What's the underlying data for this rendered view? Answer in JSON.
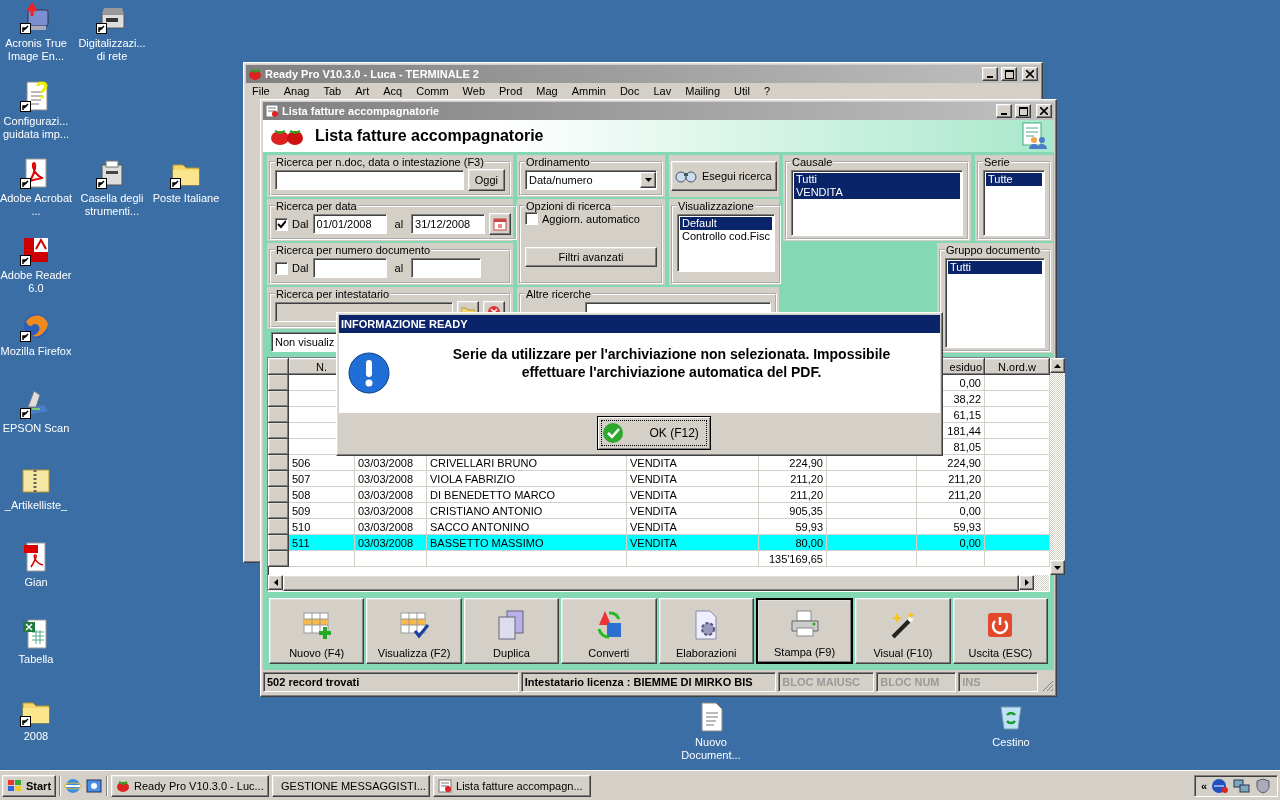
{
  "desktop_icons": [
    {
      "label": "Acronis True Image En...",
      "shortcut": true
    },
    {
      "label": "Digitalizzazi... di rete",
      "shortcut": true
    },
    {
      "label": "Configurazi... guidata imp...",
      "shortcut": true
    },
    {
      "label": "Adobe Acrobat ...",
      "shortcut": true
    },
    {
      "label": "Casella degli strumenti...",
      "shortcut": true
    },
    {
      "label": "Poste Italiane",
      "shortcut": true
    },
    {
      "label": "Adobe Reader 6.0",
      "shortcut": true
    },
    {
      "label": "Mozilla Firefox",
      "shortcut": true
    },
    {
      "label": "EPSON Scan",
      "shortcut": true
    },
    {
      "label": "_Artikelliste_",
      "shortcut": false
    },
    {
      "label": "Gian",
      "shortcut": false
    },
    {
      "label": "Tabella",
      "shortcut": false
    },
    {
      "label": "2008",
      "shortcut": true
    },
    {
      "label": "Nuovo Document...",
      "shortcut": false
    },
    {
      "label": "Cestino",
      "shortcut": false
    }
  ],
  "back_window": {
    "title": "Ready Pro V10.3.0 - Luca - TERMINALE 2",
    "menu": [
      "File",
      "Anag",
      "Tab",
      "Art",
      "Acq",
      "Comm",
      "Web",
      "Prod",
      "Mag",
      "Ammin",
      "Doc",
      "Lav",
      "Mailing",
      "Util",
      "?"
    ]
  },
  "window": {
    "title": "Lista fatture accompagnatorie",
    "heading": "Lista fatture accompagnatorie",
    "search_panel": {
      "label": "Ricerca per n.doc, data o intestazione (F3)",
      "button": "Oggi"
    },
    "date_panel": {
      "label": "Ricerca per data",
      "checkbox": {
        "label": "Dal",
        "checked": true
      },
      "from": "01/01/2008",
      "to_label": "al",
      "to": "31/12/2008"
    },
    "number_panel": {
      "label": "Ricerca per numero documento",
      "checkbox": {
        "label": "Dal",
        "checked": false
      },
      "to_label": "al"
    },
    "holder_panel": {
      "label": "Ricerca per intestatario"
    },
    "ordering": {
      "label": "Ordinamento",
      "value": "Data/numero"
    },
    "search_button": "Esegui ricerca",
    "options": {
      "label": "Opzioni di ricerca",
      "checkbox": {
        "label": "Aggiorn. automatico",
        "checked": false
      },
      "button": "Filtri avanzati"
    },
    "view": {
      "label": "Visualizzazione",
      "items": [
        {
          "label": "Default",
          "selected": true
        },
        {
          "label": "Controllo cod.Fisc",
          "selected": false
        }
      ]
    },
    "causale": {
      "label": "Causale",
      "items": [
        {
          "label": "Tutti",
          "selected": true
        },
        {
          "label": "VENDITA",
          "selected": true
        }
      ]
    },
    "serie": {
      "label": "Serie",
      "items": [
        {
          "label": "Tutte",
          "selected": true
        }
      ]
    },
    "group": {
      "label": "Gruppo documento",
      "items": [
        {
          "label": "Tutti",
          "selected": true
        }
      ]
    },
    "other": {
      "label": "Altre ricerche"
    },
    "filter_combo": "Non visualiz",
    "table": {
      "columns": [
        "N.",
        null,
        null,
        null,
        null,
        null,
        "esiduo",
        "N.ord.w"
      ],
      "rows": [
        {
          "cells": [
            null,
            null,
            null,
            null,
            null,
            null,
            "0,00",
            null
          ],
          "selected": false
        },
        {
          "cells": [
            null,
            null,
            null,
            null,
            null,
            null,
            "38,22",
            null
          ],
          "selected": false
        },
        {
          "cells": [
            null,
            null,
            null,
            null,
            null,
            null,
            "61,15",
            null
          ],
          "selected": false
        },
        {
          "cells": [
            null,
            null,
            null,
            null,
            null,
            null,
            "181,44",
            null
          ],
          "selected": false
        },
        {
          "cells": [
            null,
            null,
            null,
            null,
            null,
            null,
            "81,05",
            null
          ],
          "selected": false
        },
        {
          "cells": [
            "506",
            "03/03/2008",
            "CRIVELLARI BRUNO",
            "VENDITA",
            "224,90",
            null,
            "224,90",
            null
          ],
          "selected": false
        },
        {
          "cells": [
            "507",
            "03/03/2008",
            "VIOLA FABRIZIO",
            "VENDITA",
            "211,20",
            null,
            "211,20",
            null
          ],
          "selected": false
        },
        {
          "cells": [
            "508",
            "03/03/2008",
            "DI BENEDETTO MARCO",
            "VENDITA",
            "211,20",
            null,
            "211,20",
            null
          ],
          "selected": false
        },
        {
          "cells": [
            "509",
            "03/03/2008",
            "CRISTIANO ANTONIO",
            "VENDITA",
            "905,35",
            null,
            "0,00",
            null
          ],
          "selected": false
        },
        {
          "cells": [
            "510",
            "03/03/2008",
            "SACCO ANTONINO",
            "VENDITA",
            "59,93",
            null,
            "59,93",
            null
          ],
          "selected": false
        },
        {
          "cells": [
            "511",
            "03/03/2008",
            "BASSETTO MASSIMO",
            "VENDITA",
            "80,00",
            null,
            "0,00",
            null
          ],
          "selected": true
        },
        {
          "cells": [
            null,
            null,
            null,
            null,
            "135'169,65",
            null,
            null,
            null
          ],
          "selected": false
        }
      ]
    },
    "buttons": [
      {
        "label": "Nuovo (F4)",
        "focused": false
      },
      {
        "label": "Visualizza (F2)",
        "focused": false
      },
      {
        "label": "Duplica",
        "focused": false
      },
      {
        "label": "Converti",
        "focused": false
      },
      {
        "label": "Elaborazioni",
        "focused": false
      },
      {
        "label": "Stampa (F9)",
        "focused": true
      },
      {
        "label": "Visual (F10)",
        "focused": false
      },
      {
        "label": "Uscita (ESC)",
        "focused": false
      }
    ],
    "status_bar": [
      {
        "text": "502 record trovati",
        "active": true
      },
      {
        "text": "Intestatario licenza : BIEMME DI MIRKO BIS",
        "active": true
      },
      {
        "text": "BLOC MAIUSC",
        "active": false
      },
      {
        "text": "BLOC NUM",
        "active": false
      },
      {
        "text": "INS",
        "active": false
      }
    ]
  },
  "dialog": {
    "title": "INFORMAZIONE READY",
    "message": "Serie da utilizzare per l'archiviazione non selezionata. Impossibile effettuare l'archiviazione automatica del PDF.",
    "button": "OK (F12)"
  },
  "taskbar": {
    "start": "Start",
    "tasks": [
      {
        "label": "Ready Pro V10.3.0 - Luc...",
        "selected": false
      },
      {
        "label": "GESTIONE MESSAGGISTI...",
        "selected": false
      },
      {
        "label": "Lista fatture accompagn...",
        "selected": false
      }
    ],
    "tray_toggle": "«"
  }
}
